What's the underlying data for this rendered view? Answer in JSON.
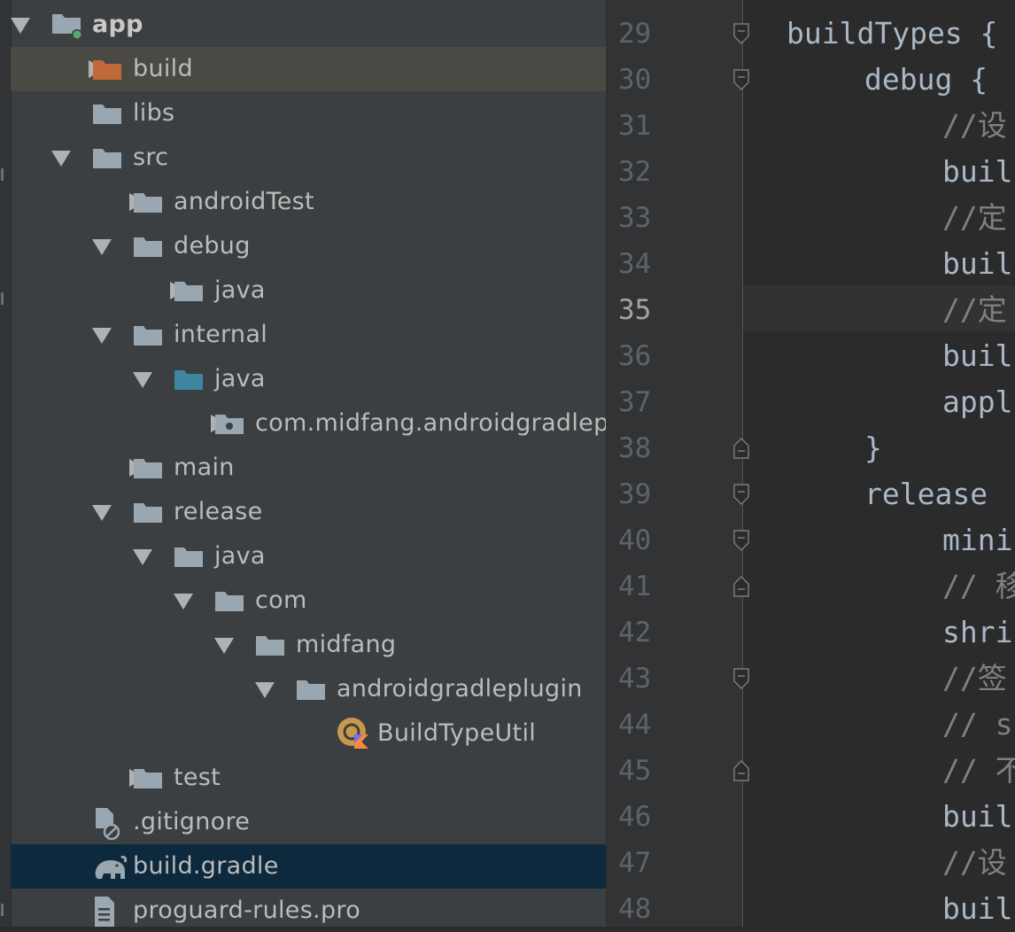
{
  "project_tree": {
    "items": [
      {
        "label": "app",
        "depth": 0,
        "arrow": "down",
        "icon": "module-folder-icon",
        "bold": true
      },
      {
        "label": "build",
        "depth": 1,
        "arrow": "right",
        "icon": "excluded-folder-icon",
        "state": "hover"
      },
      {
        "label": "libs",
        "depth": 1,
        "arrow": "none",
        "icon": "folder-icon"
      },
      {
        "label": "src",
        "depth": 1,
        "arrow": "down",
        "icon": "folder-icon"
      },
      {
        "label": "androidTest",
        "depth": 2,
        "arrow": "right",
        "icon": "folder-icon"
      },
      {
        "label": "debug",
        "depth": 2,
        "arrow": "down",
        "icon": "folder-icon"
      },
      {
        "label": "java",
        "depth": 3,
        "arrow": "right",
        "icon": "folder-icon"
      },
      {
        "label": "internal",
        "depth": 2,
        "arrow": "down",
        "icon": "folder-icon"
      },
      {
        "label": "java",
        "depth": 3,
        "arrow": "down",
        "icon": "source-folder-icon"
      },
      {
        "label": "com.midfang.androidgradlepl",
        "depth": 4,
        "arrow": "right",
        "icon": "package-icon"
      },
      {
        "label": "main",
        "depth": 2,
        "arrow": "right",
        "icon": "folder-icon"
      },
      {
        "label": "release",
        "depth": 2,
        "arrow": "down",
        "icon": "folder-icon"
      },
      {
        "label": "java",
        "depth": 3,
        "arrow": "down",
        "icon": "folder-icon"
      },
      {
        "label": "com",
        "depth": 4,
        "arrow": "down",
        "icon": "folder-icon"
      },
      {
        "label": "midfang",
        "depth": 5,
        "arrow": "down",
        "icon": "folder-icon"
      },
      {
        "label": "androidgradleplugin",
        "depth": 6,
        "arrow": "down",
        "icon": "folder-icon"
      },
      {
        "label": "BuildTypeUtil",
        "depth": 7,
        "arrow": "none",
        "icon": "kotlin-object-icon"
      },
      {
        "label": "test",
        "depth": 2,
        "arrow": "right",
        "icon": "folder-icon"
      },
      {
        "label": ".gitignore",
        "depth": 1,
        "arrow": "none",
        "icon": "ignored-file-icon"
      },
      {
        "label": "build.gradle",
        "depth": 1,
        "arrow": "none",
        "icon": "gradle-elephant-icon",
        "state": "selected"
      },
      {
        "label": "proguard-rules.pro",
        "depth": 1,
        "arrow": "none",
        "icon": "text-file-icon"
      }
    ]
  },
  "editor": {
    "current_line": "35",
    "lines": [
      {
        "num": "29",
        "indent": 0,
        "text": "buildTypes {",
        "kind": "kw",
        "fold": "open"
      },
      {
        "num": "30",
        "indent": 1,
        "text": "debug {",
        "kind": "kw",
        "fold": "open"
      },
      {
        "num": "31",
        "indent": 2,
        "text": "//设",
        "kind": "cm",
        "fold": "none"
      },
      {
        "num": "32",
        "indent": 2,
        "text": "buil",
        "kind": "kw",
        "fold": "none"
      },
      {
        "num": "33",
        "indent": 2,
        "text": "//定",
        "kind": "cm",
        "fold": "none"
      },
      {
        "num": "34",
        "indent": 2,
        "text": "buil",
        "kind": "kw",
        "fold": "none"
      },
      {
        "num": "35",
        "indent": 2,
        "text": "//定",
        "kind": "cm",
        "fold": "none"
      },
      {
        "num": "36",
        "indent": 2,
        "text": "buil",
        "kind": "kw",
        "fold": "none"
      },
      {
        "num": "37",
        "indent": 2,
        "text": "appl",
        "kind": "kw",
        "fold": "none"
      },
      {
        "num": "38",
        "indent": 1,
        "text": "}",
        "kind": "kw",
        "fold": "close"
      },
      {
        "num": "39",
        "indent": 1,
        "text": "release",
        "kind": "kw",
        "fold": "open"
      },
      {
        "num": "40",
        "indent": 2,
        "text": "mini",
        "kind": "kw",
        "fold": "open"
      },
      {
        "num": "41",
        "indent": 2,
        "text": "// 移",
        "kind": "cm",
        "fold": "close"
      },
      {
        "num": "42",
        "indent": 2,
        "text": "shri",
        "kind": "kw",
        "fold": "none"
      },
      {
        "num": "43",
        "indent": 2,
        "text": "//签",
        "kind": "cm",
        "fold": "open"
      },
      {
        "num": "44",
        "indent": 2,
        "text": "// s",
        "kind": "cm",
        "fold": "none"
      },
      {
        "num": "45",
        "indent": 2,
        "text": "// 不",
        "kind": "cm",
        "fold": "close"
      },
      {
        "num": "46",
        "indent": 2,
        "text": "buil",
        "kind": "kw",
        "fold": "none"
      },
      {
        "num": "47",
        "indent": 2,
        "text": "//设",
        "kind": "cm",
        "fold": "none"
      },
      {
        "num": "48",
        "indent": 2,
        "text": "buil",
        "kind": "kw",
        "fold": "none"
      }
    ]
  }
}
